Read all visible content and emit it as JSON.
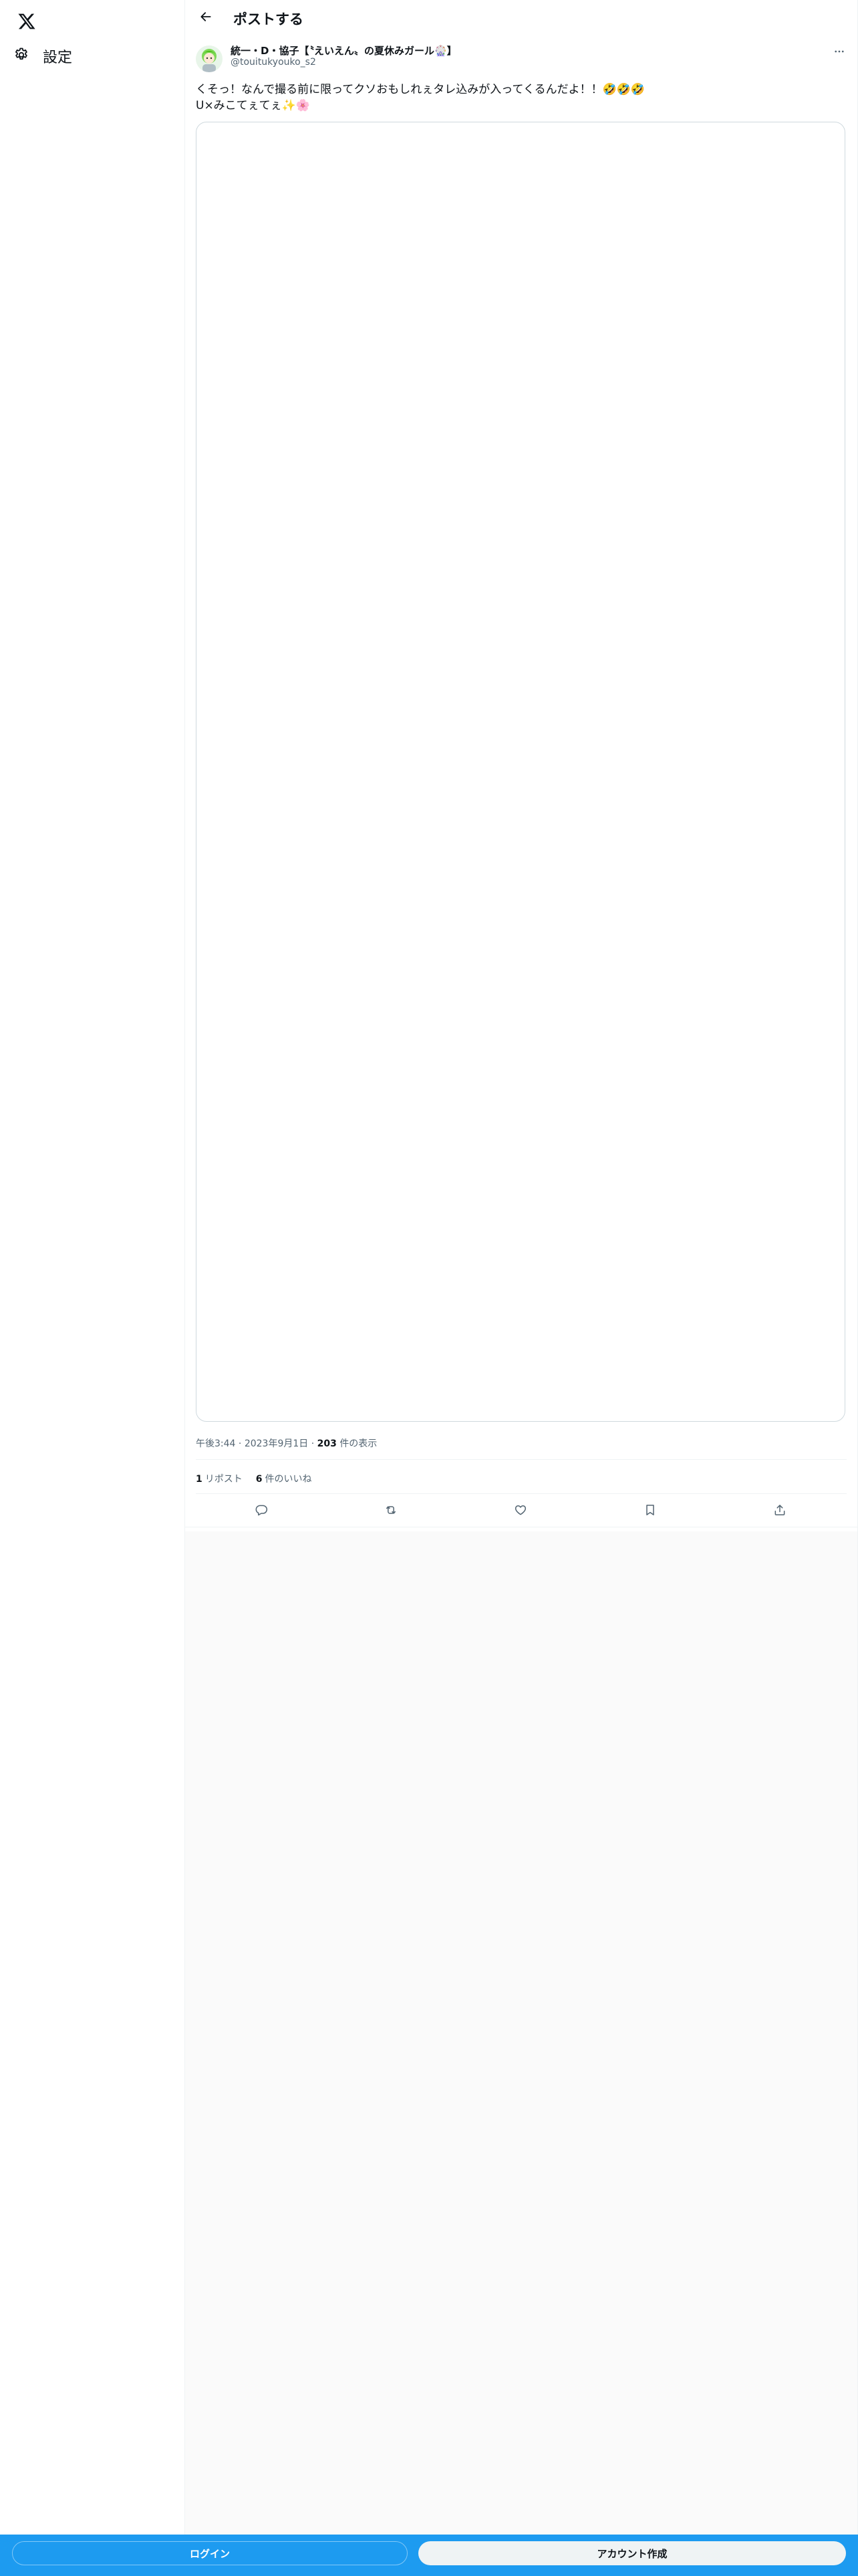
{
  "nav": {
    "settings_label": "設定"
  },
  "header": {
    "title": "ポストする"
  },
  "tweet": {
    "author_name": "統一・D・協子【〝えいえん〟の夏休みガール🎡】",
    "author_handle": "@touitukyouko_s2",
    "text_line1": "くそっ！なんで撮る前に限ってクソおもしれぇタレ込みが入ってくるんだよ！！🤣🤣🤣",
    "text_line2": "U×みこてぇてぇ✨🌸",
    "time": "午後3:44",
    "date": "2023年9月1日",
    "views_count": "203",
    "views_label": "件の表示",
    "reposts_count": "1",
    "reposts_label": "リポスト",
    "likes_count": "6",
    "likes_label": "件のいいね"
  },
  "bottom_bar": {
    "login_label": "ログイン",
    "signup_label": "アカウント作成"
  },
  "colors": {
    "accent": "#1d9bf0",
    "text_primary": "#0f1419",
    "text_secondary": "#536471",
    "border": "#eff3f4"
  },
  "icons": {
    "logo": "x-logo-icon",
    "settings": "gear-icon",
    "back": "arrow-left-icon",
    "more": "more-dots-icon",
    "reply": "reply-icon",
    "repost": "repost-icon",
    "like": "heart-icon",
    "bookmark": "bookmark-icon",
    "share": "share-icon"
  }
}
